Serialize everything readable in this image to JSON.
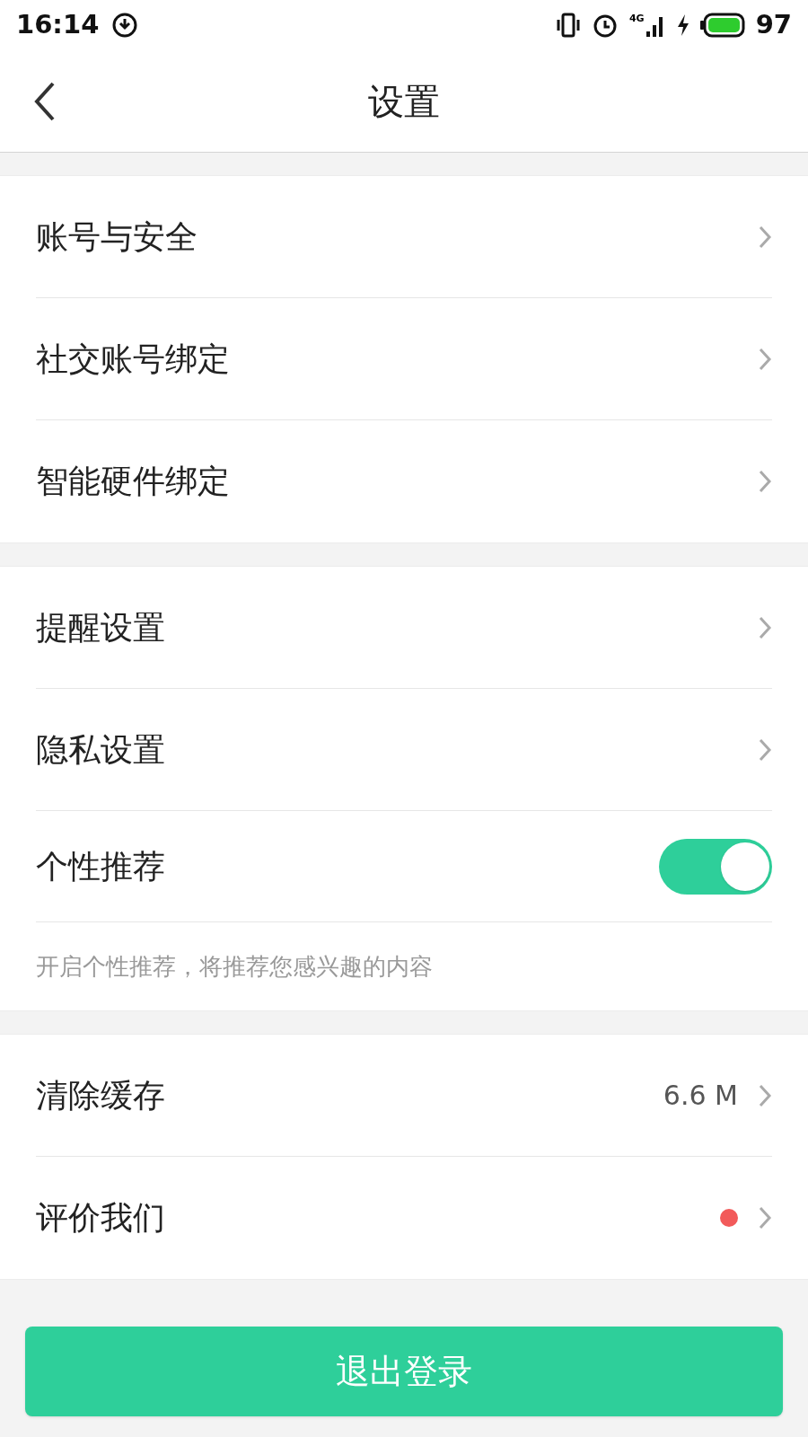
{
  "status_bar": {
    "time": "16:14",
    "network": "4G",
    "battery": "97"
  },
  "header": {
    "title": "设置"
  },
  "sections": [
    {
      "items": [
        {
          "kind": "link",
          "label": "账号与安全"
        },
        {
          "kind": "link",
          "label": "社交账号绑定"
        },
        {
          "kind": "link",
          "label": "智能硬件绑定"
        }
      ]
    },
    {
      "items": [
        {
          "kind": "link",
          "label": "提醒设置"
        },
        {
          "kind": "link",
          "label": "隐私设置"
        },
        {
          "kind": "toggle",
          "label": "个性推荐",
          "on": true
        },
        {
          "kind": "hint",
          "label": "开启个性推荐，将推荐您感兴趣的内容"
        }
      ]
    },
    {
      "items": [
        {
          "kind": "link",
          "label": "清除缓存",
          "value": "6.6 M"
        },
        {
          "kind": "link",
          "label": "评价我们",
          "color": "#f25a5a"
        }
      ]
    }
  ],
  "logout_button": "退出登录"
}
